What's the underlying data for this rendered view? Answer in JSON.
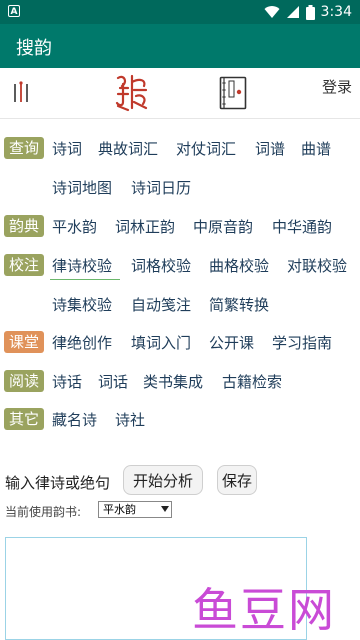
{
  "status_bar": {
    "time": "3:34",
    "left_icon_letter": "A"
  },
  "app_bar": {
    "title": "搜韵"
  },
  "toolbar": {
    "login_label": "登录"
  },
  "colors": {
    "status_bar": "#00695c",
    "app_bar": "#00796b",
    "tag_query": "#9aa35f",
    "tag_rhyme": "#9aa35f",
    "tag_proof": "#9aa35f",
    "tag_class": "#e0925a",
    "tag_read": "#9aa35f",
    "tag_other": "#9aa35f",
    "link_text": "#1f3d5a",
    "watermark": "#c94bd6"
  },
  "sections": [
    {
      "tag": "查询",
      "links": [
        "诗词",
        "典故词汇",
        "对仗词汇",
        "词谱",
        "曲谱",
        "诗词地图",
        "诗词日历"
      ]
    },
    {
      "tag": "韵典",
      "links": [
        "平水韵",
        "词林正韵",
        "中原音韵",
        "中华通韵"
      ]
    },
    {
      "tag": "校注",
      "links": [
        "律诗校验",
        "词格校验",
        "曲格校验",
        "对联校验",
        "诗集校验",
        "自动笺注",
        "简繁转换"
      ]
    },
    {
      "tag": "课堂",
      "links": [
        "律绝创作",
        "填词入门",
        "公开课",
        "学习指南"
      ]
    },
    {
      "tag": "阅读",
      "links": [
        "诗话",
        "词话",
        "类书集成",
        "古籍检索"
      ]
    },
    {
      "tag": "其它",
      "links": [
        "藏名诗",
        "诗社"
      ]
    }
  ],
  "panel": {
    "prompt": "输入律诗或绝句",
    "analyze_label": "开始分析",
    "save_label": "保存",
    "rhyme_book_label": "当前使用韵书:",
    "rhyme_book_selected": "平水韵"
  },
  "watermark": "鱼豆网"
}
